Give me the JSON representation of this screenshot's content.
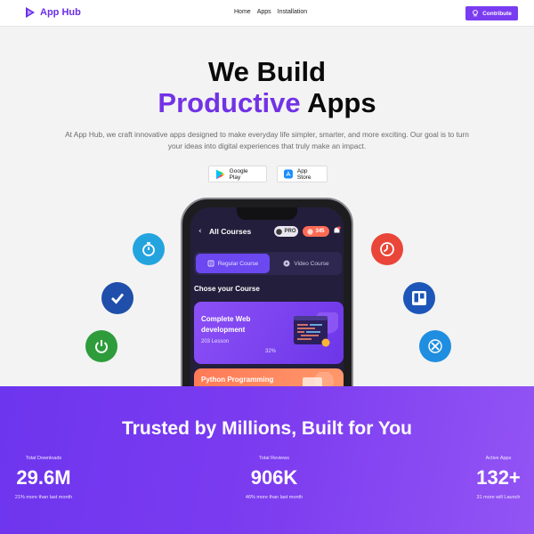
{
  "nav": {
    "brand": "App Hub",
    "links": [
      "Home",
      "Apps",
      "Installation"
    ],
    "contribute_label": "Contribute",
    "colors": {
      "brand": "#6a2ee8",
      "button": "#7a3cf0"
    }
  },
  "hero": {
    "title_line1": "We Build",
    "title_accent": "Productive",
    "title_rest": "Apps",
    "subtitle": "At App Hub, we craft innovative apps designed to make everyday life simpler, smarter, and more exciting. Our goal is to turn your ideas into digital experiences that truly make an impact.",
    "google_play_label": "Google Play",
    "app_store_label": "App Store",
    "accent_color": "#7232e6"
  },
  "floating_icons": [
    "timer-icon",
    "check-icon",
    "power-icon",
    "clock-icon",
    "trello-icon",
    "tools-icon"
  ],
  "phone": {
    "title": "All Courses",
    "pro_badge": "PRO",
    "points": "345",
    "tab_regular": "Regular Course",
    "tab_video": "Video Course",
    "section_title": "Chose your Course",
    "course1": {
      "title": "Complete Web development",
      "lessons": "203 Lesson",
      "progress": "32%"
    },
    "course2": {
      "title": "Python Programming"
    }
  },
  "stats": {
    "title": "Trusted by Millions, Built for You",
    "items": [
      {
        "label": "Total Downloads",
        "value": "29.6M",
        "note": "21% more than last month"
      },
      {
        "label": "Total Reviews",
        "value": "906K",
        "note": "46% more than last month"
      },
      {
        "label": "Active Apps",
        "value": "132+",
        "note": "31 more will Launch"
      }
    ]
  }
}
